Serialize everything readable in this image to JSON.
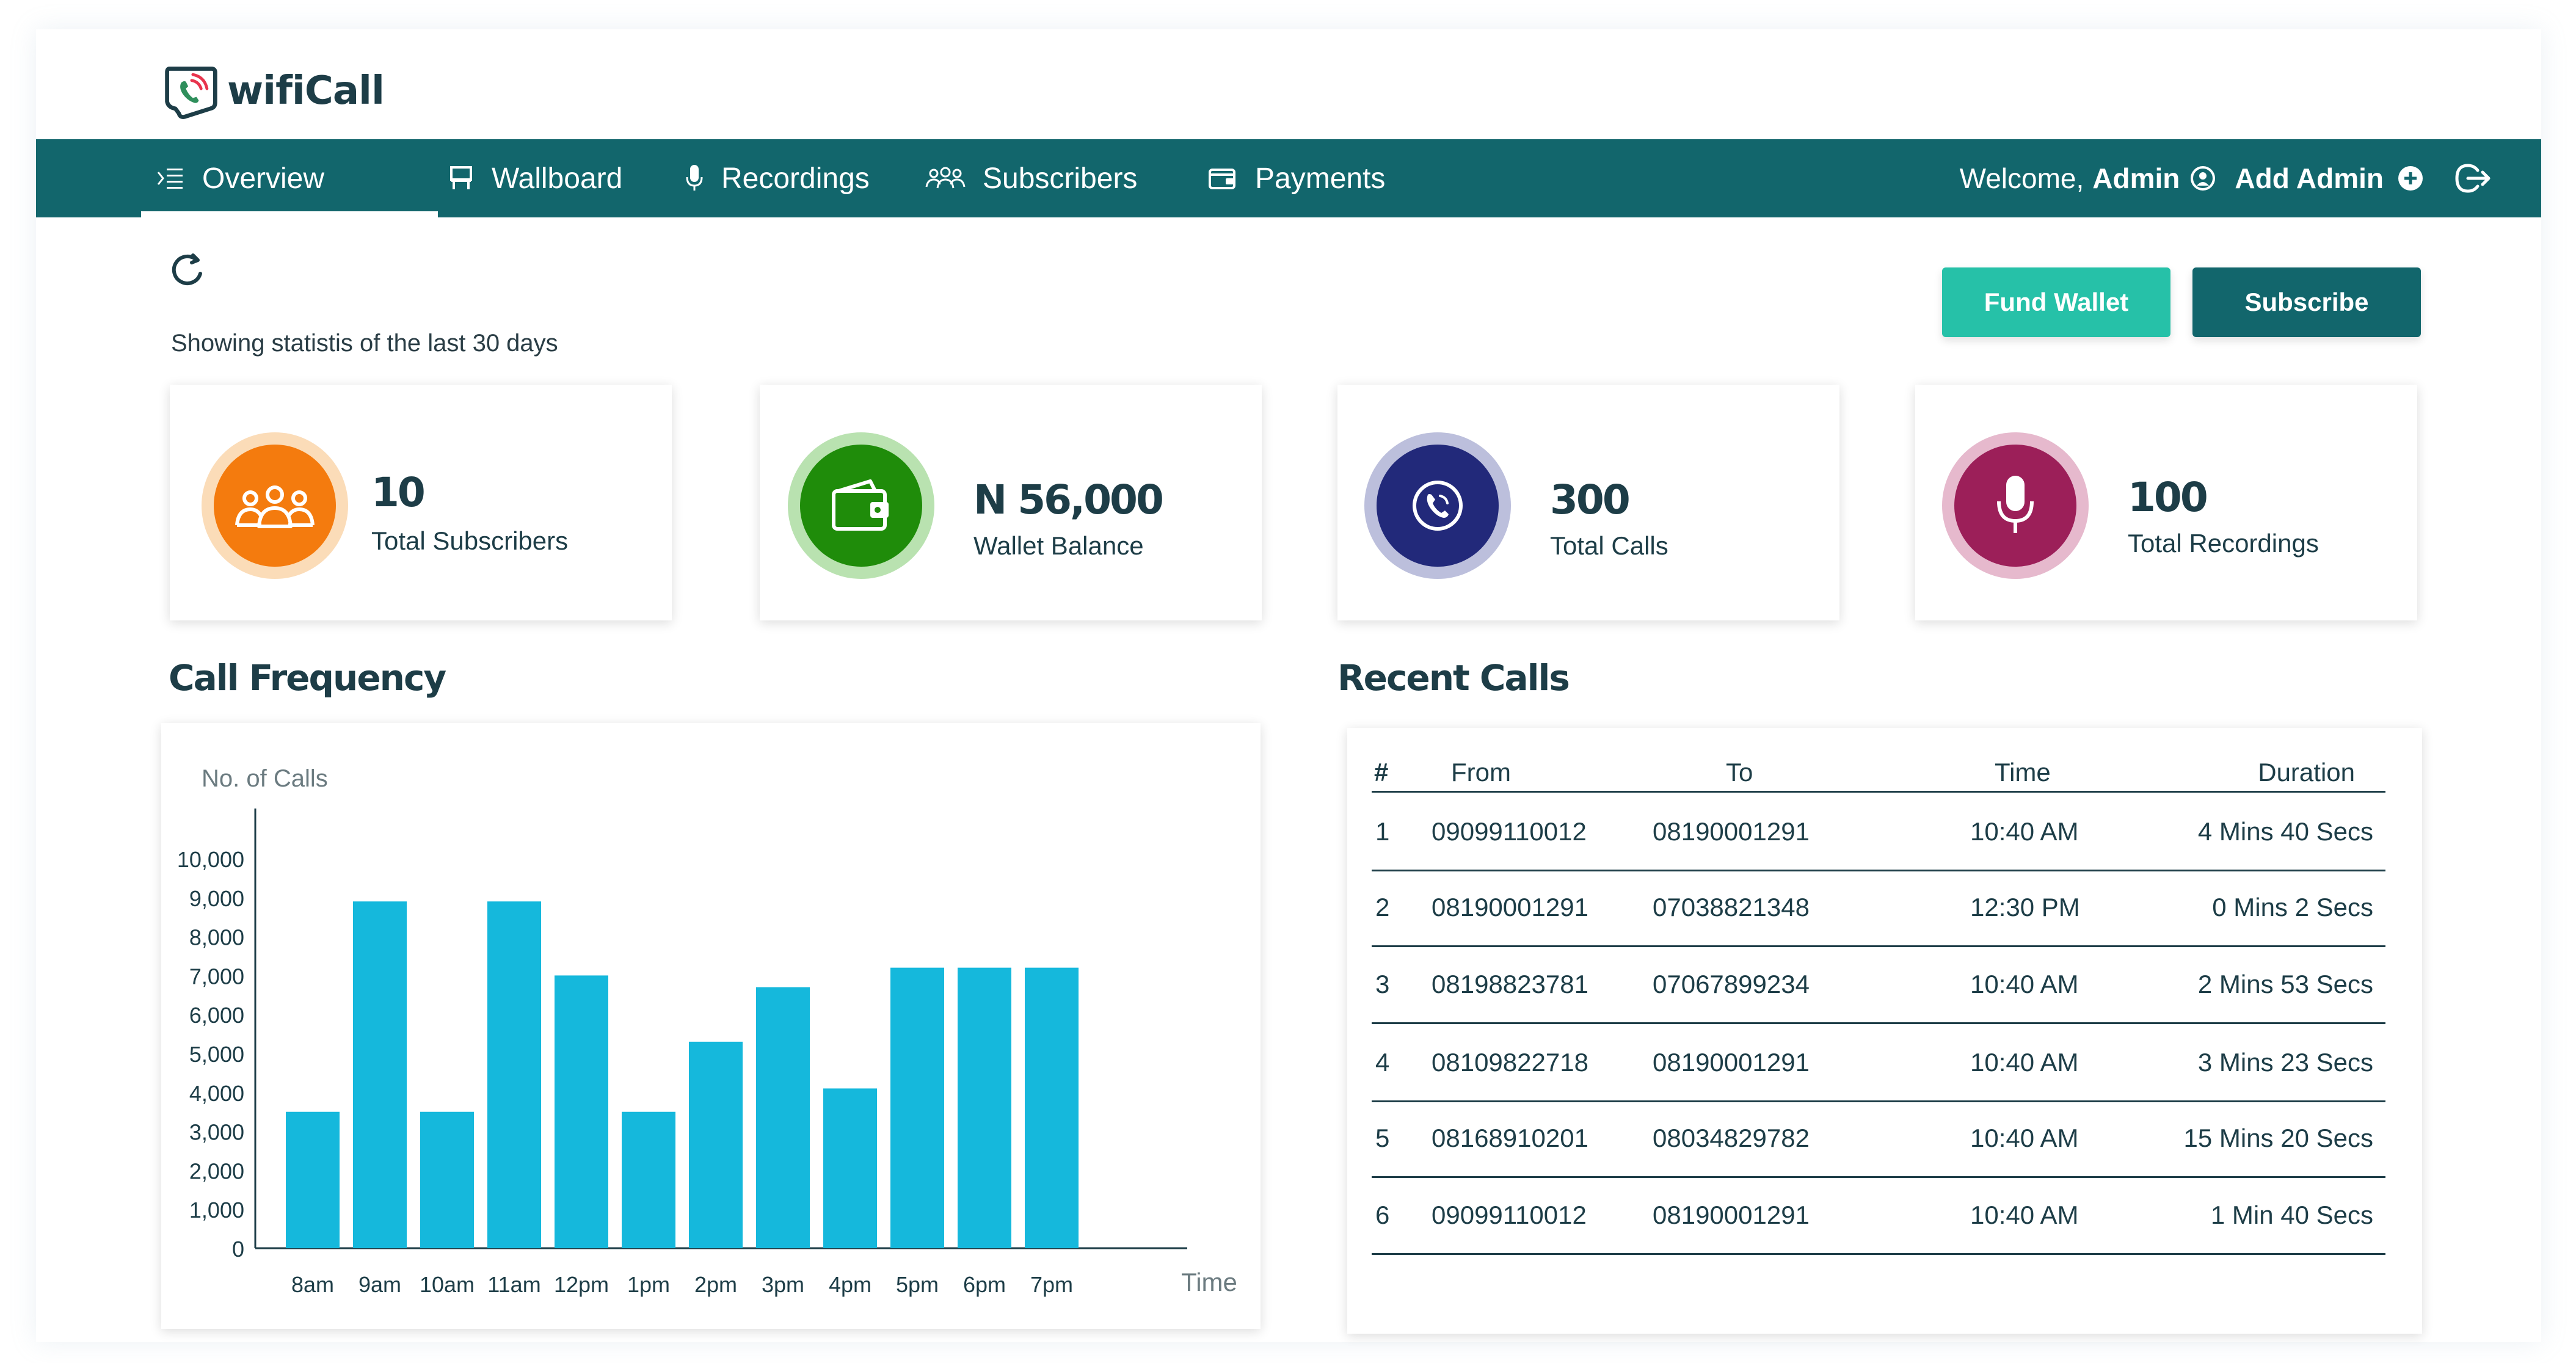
{
  "app": {
    "logo_text": "wifiCall"
  },
  "nav": {
    "items": [
      {
        "label": "Overview",
        "icon": "overview-icon",
        "active": true
      },
      {
        "label": "Wallboard",
        "icon": "wallboard-icon"
      },
      {
        "label": "Recordings",
        "icon": "microphone-icon"
      },
      {
        "label": "Subscribers",
        "icon": "users-icon"
      },
      {
        "label": "Payments",
        "icon": "wallet-icon"
      }
    ],
    "welcome": "Welcome,",
    "user": "Admin",
    "add_admin": "Add Admin"
  },
  "toolbar": {
    "caption": "Showing statistis of the last 30 days",
    "fund_wallet": "Fund Wallet",
    "subscribe": "Subscribe"
  },
  "stats": [
    {
      "value": "10",
      "label": "Total Subscribers",
      "icon": "subscribers-icon",
      "color": "#f47b0e"
    },
    {
      "value": "N 56,000",
      "label": "Wallet Balance",
      "icon": "wallet-icon",
      "color": "#1f8c0a"
    },
    {
      "value": "300",
      "label": "Total Calls",
      "icon": "phone-call-icon",
      "color": "#22297a"
    },
    {
      "value": "100",
      "label": "Total Recordings",
      "icon": "microphone-icon",
      "color": "#9c1f59"
    }
  ],
  "sections": {
    "call_frequency": "Call Frequency",
    "recent_calls": "Recent Calls"
  },
  "chart_data": {
    "type": "bar",
    "ylabel": "No. of Calls",
    "xlabel": "Time",
    "categories": [
      "8am",
      "9am",
      "10am",
      "11am",
      "12pm",
      "1pm",
      "2pm",
      "3pm",
      "4pm",
      "5pm",
      "6pm",
      "7pm"
    ],
    "values": [
      3500,
      8900,
      3500,
      8900,
      7000,
      3500,
      5300,
      6700,
      4100,
      7200,
      7200,
      7200
    ],
    "yticks": [
      "0",
      "1,000",
      "2,000",
      "3,000",
      "4,000",
      "5,000",
      "6,000",
      "7,000",
      "8,000",
      "9,000",
      "10,000"
    ],
    "ylim": [
      0,
      10000
    ],
    "color": "#15b8dc"
  },
  "recent_calls": {
    "headers": [
      "#",
      "From",
      "To",
      "Time",
      "Duration"
    ],
    "rows": [
      [
        "1",
        "09099110012",
        "08190001291",
        "10:40 AM",
        "4 Mins 40 Secs"
      ],
      [
        "2",
        "08190001291",
        "07038821348",
        "12:30 PM",
        "0 Mins 2 Secs"
      ],
      [
        "3",
        "08198823781",
        "07067899234",
        "10:40 AM",
        "2 Mins 53 Secs"
      ],
      [
        "4",
        "08109822718",
        "08190001291",
        "10:40 AM",
        "3 Mins 23 Secs"
      ],
      [
        "5",
        "08168910201",
        "08034829782",
        "10:40 AM",
        "15 Mins 20 Secs"
      ],
      [
        "6",
        "09099110012",
        "08190001291",
        "10:40 AM",
        "1 Min 40 Secs"
      ]
    ]
  }
}
